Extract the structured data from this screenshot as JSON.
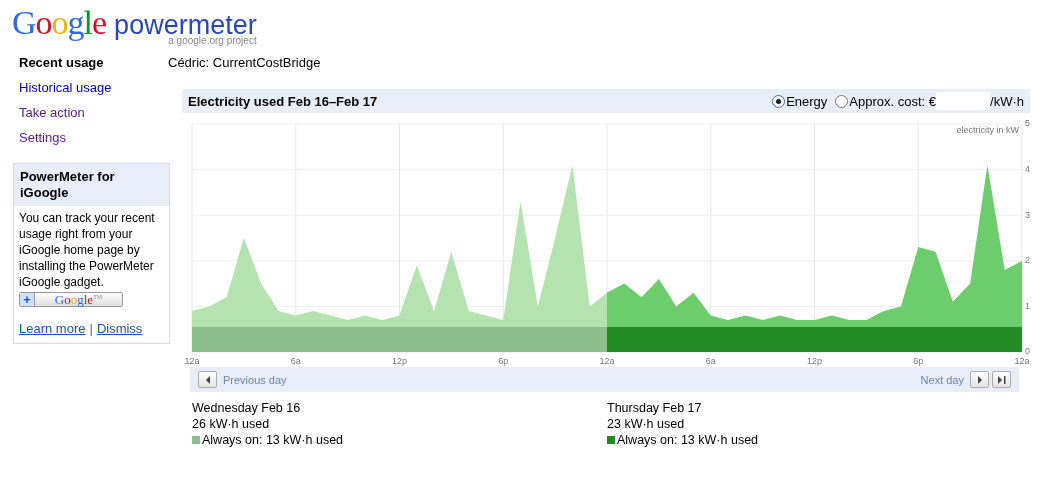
{
  "logo": {
    "brand": "Google",
    "product": "powermeter",
    "tagline": "a google.org project"
  },
  "sidebar": {
    "items": [
      {
        "label": "Recent usage",
        "selected": true
      },
      {
        "label": "Historical usage",
        "selected": false,
        "visited": false
      },
      {
        "label": "Take action",
        "selected": false,
        "visited": true
      },
      {
        "label": "Settings",
        "selected": false,
        "visited": true
      }
    ],
    "promo": {
      "title": "PowerMeter for iGoogle",
      "body": "You can track your recent usage right from your iGoogle home page by installing the PowerMeter iGoogle gadget.",
      "button": {
        "plus": "+",
        "brand": "Google",
        "mark": "TM"
      },
      "links": [
        "Learn more",
        "Dismiss"
      ],
      "separator": "|"
    }
  },
  "device": "Cédric: CurrentCostBridge",
  "panel": {
    "title": "Electricity used Feb 16–Feb 17",
    "modes": [
      {
        "label": "Energy",
        "selected": true
      },
      {
        "label": "Approx. cost: €",
        "selected": false
      }
    ],
    "unit": "/kW·h",
    "chart_data": {
      "type": "area",
      "ylabel": "electricity in kW",
      "categories": [
        "12a",
        null,
        null,
        null,
        null,
        null,
        "6a",
        null,
        null,
        null,
        null,
        null,
        "12p",
        null,
        null,
        null,
        null,
        null,
        "6p",
        null,
        null,
        null,
        null,
        null,
        "12a",
        null,
        null,
        null,
        null,
        null,
        "6a",
        null,
        null,
        null,
        null,
        null,
        "12p",
        null,
        null,
        null,
        null,
        null,
        "6p",
        null,
        null,
        null,
        null,
        null,
        "12a"
      ],
      "yticks": [
        0,
        1,
        2,
        3,
        4,
        5
      ],
      "ylim": [
        0,
        5
      ],
      "grid": true,
      "series": [
        {
          "color": "#b4e3b0",
          "values": [
            0.9,
            1.0,
            1.2,
            2.5,
            1.5,
            0.9,
            0.8,
            0.9,
            0.8,
            0.7,
            0.8,
            0.7,
            0.8,
            1.9,
            0.9,
            2.2,
            0.9,
            0.8,
            0.7,
            3.3,
            1.0,
            2.5,
            4.1,
            1.0,
            1.3,
            null,
            null,
            null,
            null,
            null,
            null,
            null,
            null,
            null,
            null,
            null,
            null,
            null,
            null,
            null,
            null,
            null,
            null,
            null,
            null,
            null,
            null,
            null,
            null
          ]
        },
        {
          "color": "#6dcd6d",
          "values": [
            null,
            null,
            null,
            null,
            null,
            null,
            null,
            null,
            null,
            null,
            null,
            null,
            null,
            null,
            null,
            null,
            null,
            null,
            null,
            null,
            null,
            null,
            null,
            null,
            1.3,
            1.5,
            1.2,
            1.6,
            1.0,
            1.3,
            0.8,
            0.7,
            0.8,
            0.7,
            0.8,
            0.7,
            0.7,
            0.8,
            0.7,
            0.7,
            0.9,
            1.0,
            2.3,
            2.2,
            1.1,
            1.5,
            4.1,
            1.8,
            2.0
          ]
        },
        {
          "color": "#8cbf8c",
          "values": [
            0.55,
            0.55,
            0.55,
            0.55,
            0.55,
            0.55,
            0.55,
            0.55,
            0.55,
            0.55,
            0.55,
            0.55,
            0.55,
            0.55,
            0.55,
            0.55,
            0.55,
            0.55,
            0.55,
            0.55,
            0.55,
            0.55,
            0.55,
            0.55,
            0.55,
            null,
            null,
            null,
            null,
            null,
            null,
            null,
            null,
            null,
            null,
            null,
            null,
            null,
            null,
            null,
            null,
            null,
            null,
            null,
            null,
            null,
            null,
            null,
            null
          ]
        },
        {
          "color": "#238b23",
          "values": [
            null,
            null,
            null,
            null,
            null,
            null,
            null,
            null,
            null,
            null,
            null,
            null,
            null,
            null,
            null,
            null,
            null,
            null,
            null,
            null,
            null,
            null,
            null,
            null,
            0.55,
            0.55,
            0.55,
            0.55,
            0.55,
            0.55,
            0.55,
            0.55,
            0.55,
            0.55,
            0.55,
            0.55,
            0.55,
            0.55,
            0.55,
            0.55,
            0.55,
            0.55,
            0.55,
            0.55,
            0.55,
            0.55,
            0.55,
            0.55,
            0.55
          ]
        }
      ]
    },
    "nav": {
      "previous": "Previous day",
      "next": "Next day"
    },
    "days": [
      {
        "date": "Wednesday Feb 16",
        "used": "26 kW·h used",
        "always_on": "Always on: 13 kW·h used",
        "color": "#8cbf8c"
      },
      {
        "date": "Thursday Feb 17",
        "used": "23 kW·h used",
        "always_on": "Always on: 13 kW·h used",
        "color": "#238b23"
      }
    ]
  }
}
